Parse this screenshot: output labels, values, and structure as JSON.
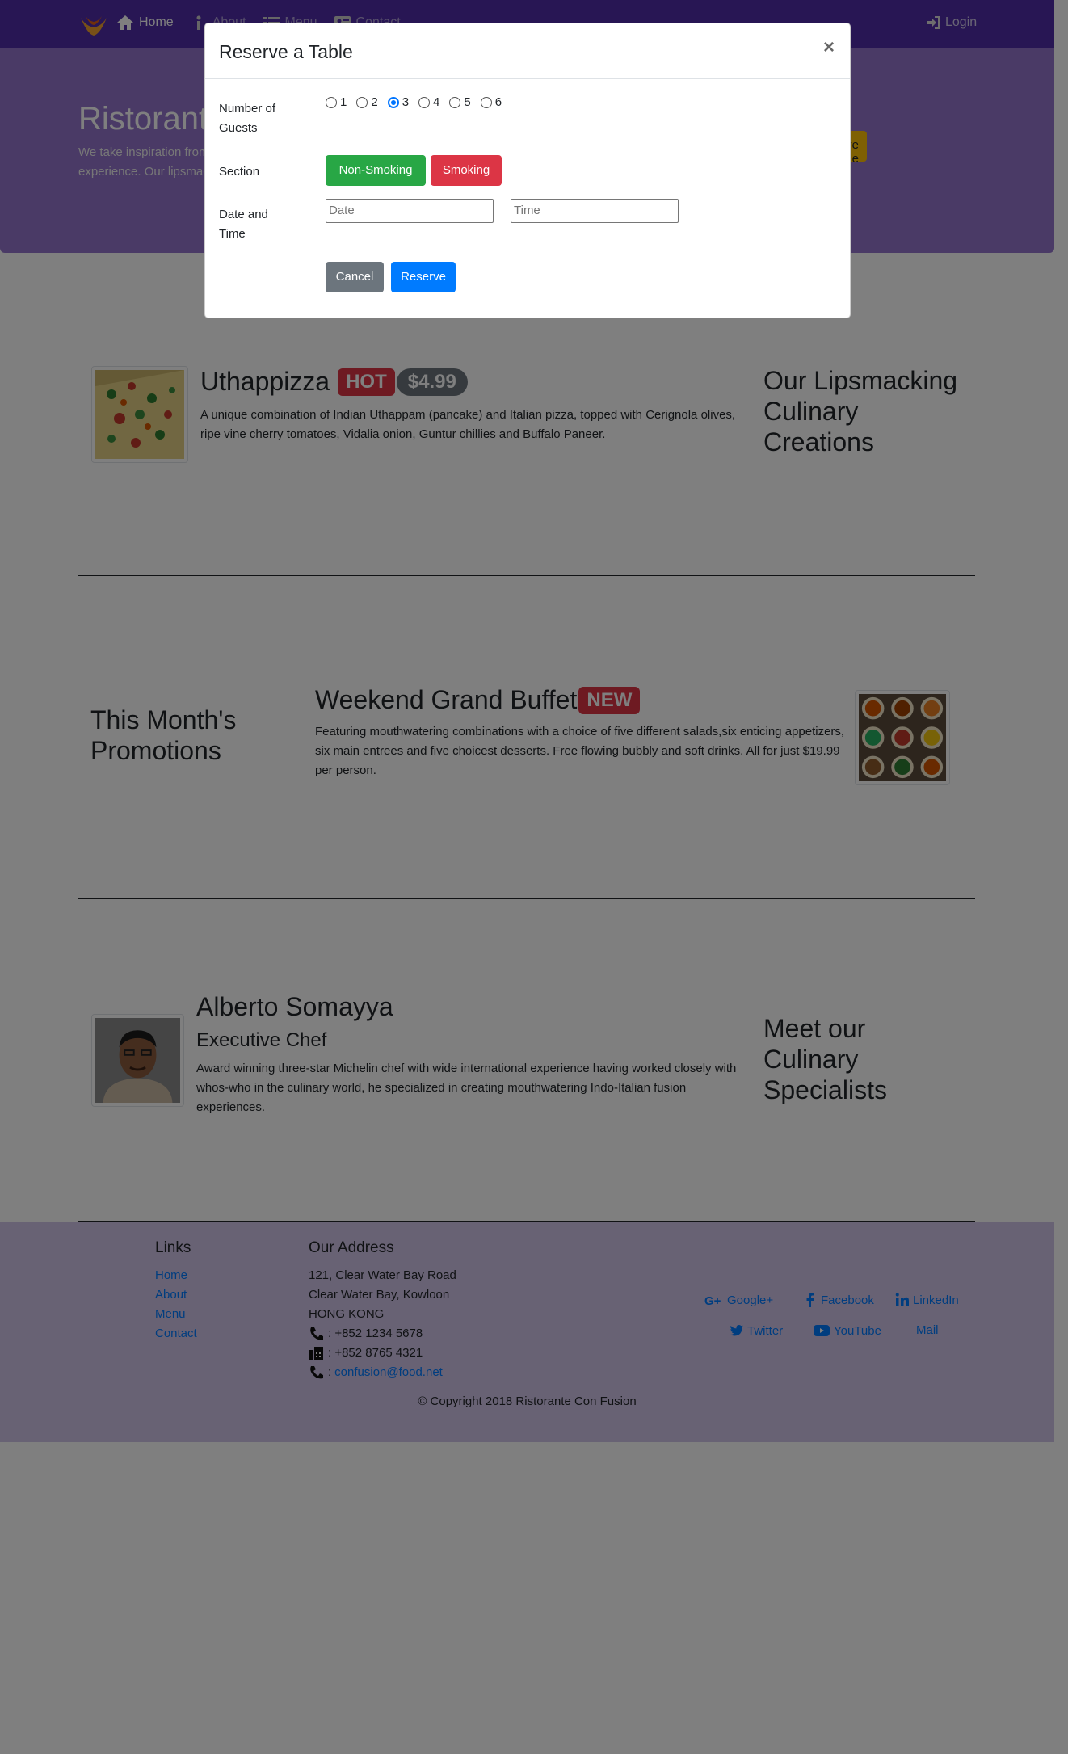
{
  "navbar": {
    "logo": "logo-icon",
    "items": [
      {
        "label": "Home",
        "icon": "home-icon"
      },
      {
        "label": "About",
        "icon": "info-icon"
      },
      {
        "label": "Menu",
        "icon": "list-icon"
      },
      {
        "label": "Contact",
        "icon": "address-card-icon"
      }
    ],
    "login_label": "Login"
  },
  "jumbotron": {
    "title": "Ristorante Con Fusion",
    "text": "We take inspiration from the World's best cuisines, and create a unique fusion experience. Our lipsmacking creations will tickle your culinary senses!",
    "reserve_label": "Reserve Table"
  },
  "dish": {
    "name": "Uthappizza",
    "badge": "HOT",
    "price": "$4.99",
    "description": "A unique combination of Indian Uthappam (pancake) and Italian pizza, topped with Cerignola olives, ripe vine cherry tomatoes, Vidalia onion, Guntur chillies and Buffalo Paneer.",
    "side_heading": "Our Lipsmacking Culinary Creations"
  },
  "promotion": {
    "side_heading": "This Month's Promotions",
    "name": "Weekend Grand Buffet",
    "badge": "NEW",
    "description": "Featuring mouthwatering combinations with a choice of five different salads,six enticing appetizers, six main entrees and five choicest desserts. Free flowing bubbly and soft drinks. All for just $19.99 per person."
  },
  "leader": {
    "name": "Alberto Somayya",
    "designation": "Executive Chef",
    "description": "Award winning three-star Michelin chef with wide international experience having worked closely with whos-who in the culinary world, he specialized in creating mouthwatering Indo-Italian fusion experiences.",
    "side_heading": "Meet our Culinary Specialists"
  },
  "footer": {
    "links_heading": "Links",
    "links": [
      "Home",
      "About",
      "Menu",
      "Contact"
    ],
    "address_heading": "Our Address",
    "address_lines": [
      "121, Clear Water Bay Road",
      "Clear Water Bay, Kowloon",
      "HONG KONG"
    ],
    "phone": ": +852 1234 5678",
    "fax": ": +852 8765 4321",
    "email_prefix": ": ",
    "email": "confusion@food.net",
    "social": [
      {
        "label": "Google+",
        "icon": "google-plus-icon"
      },
      {
        "label": "Facebook",
        "icon": "facebook-icon"
      },
      {
        "label": "LinkedIn",
        "icon": "linkedin-icon"
      },
      {
        "label": "Twitter",
        "icon": "twitter-icon"
      },
      {
        "label": "YouTube",
        "icon": "youtube-icon"
      },
      {
        "label": "Mail",
        "icon": "envelope-icon"
      }
    ],
    "copyright": "© Copyright 2018 Ristorante Con Fusion"
  },
  "modal": {
    "title": "Reserve a Table",
    "close": "×",
    "guests_label_1": "Number of",
    "guests_label_2": "Guests",
    "guest_options": [
      "1",
      "2",
      "3",
      "4",
      "5",
      "6"
    ],
    "guests_selected": "3",
    "section_label": "Section",
    "non_smoking_label": "Non-Smoking",
    "smoking_label": "Smoking",
    "datetime_label_1": "Date and",
    "datetime_label_2": "Time",
    "date_placeholder": "Date",
    "time_placeholder": "Time",
    "cancel_label": "Cancel",
    "reserve_label": "Reserve"
  },
  "colors": {
    "navbar": "#512da8",
    "jumbotron": "#9575cd",
    "footer": "#d1c4e9",
    "success": "#28a745",
    "danger": "#dc3545",
    "primary": "#007bff",
    "secondary": "#6c757d"
  }
}
